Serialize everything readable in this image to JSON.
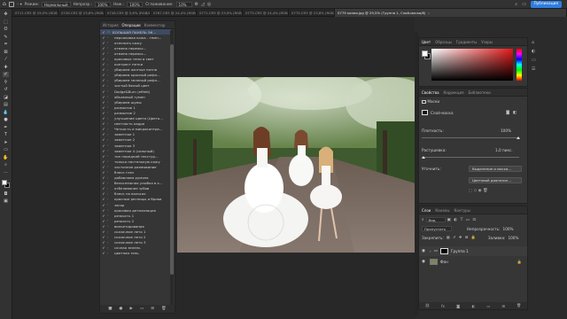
{
  "options_bar": {
    "mode_label": "Режим:",
    "mode_value": "Нормальный",
    "opacity_label": "Непрозр.:",
    "opacity_value": "100%",
    "flow_label": "Наж.:",
    "flow_value": "100%",
    "smoothing_label": "Сглаживание:",
    "smoothing_value": "10%",
    "share_label": "Публикация"
  },
  "tabs": [
    {
      "label": "0711.CR3 @ 29,5% (RGB/8...",
      "active": false
    },
    {
      "label": "0726.CR3 @ 23,8% (RGB/8)",
      "active": false
    },
    {
      "label": "0728.CR3 @ 5,6% (RGB/8)",
      "active": false
    },
    {
      "label": "0767.CR3 @ 24,4% (RGB/8)",
      "active": false
    },
    {
      "label": "0771.CR3 @ 23,9% (RGB/8)",
      "active": false
    },
    {
      "label": "0773.CR3 @ 24,4% (RGB/8)",
      "active": false
    },
    {
      "label": "0775.CR3 @ 23,8% (RGB/8)",
      "active": false
    },
    {
      "label": "0779 копия.jpg @ 29,5% (Группа 1, Слой-маска/8)",
      "active": true
    }
  ],
  "history": {
    "tabs": [
      "История",
      "Операции",
      "Комментар"
    ],
    "group_title": "БОЛЬШАЯ ПАНЕЛЬ ЭК...",
    "items": [
      "персиковая кожа - темн...",
      "отеплить кожу",
      "отмена переокс...",
      "отмена переокс...",
      "красивые тени и свет",
      "контраст нетки",
      "убираем желтые пятна",
      "убираем красный рефл...",
      "убираем зеленый рефл...",
      "чистый белый цвет",
      "Dodge&Burn (effekt)",
      "объемный тумен",
      "убираем шумы",
      "размытие 1",
      "размытие 2",
      "улучшение цвета (Цвето...",
      "светлость кадра",
      "Четкость и микроконтра...",
      "заметное 1",
      "заметное 2",
      "заметное 3",
      "заметное 4 (сильный)",
      "тон передний текстур...",
      "только пастельную кожу",
      "частичное размывание",
      "блеск глаз",
      "добавляем румяна",
      "белоснежная улыбка в к...",
      "отбеливание зубов",
      "блеск на волосах",
      "красные ресницы и брови",
      "загар",
      "красивая детализация",
      "резкость 1",
      "резкость 2",
      "виньетирование",
      "сказочное лето 1",
      "сказочное лето 2",
      "сказочное лето 3",
      "сочная зелень",
      "цветная тень"
    ]
  },
  "color_panel": {
    "tabs": [
      "Цвет",
      "Образцы",
      "Градиенты",
      "Узоры"
    ],
    "accent": "#e31919"
  },
  "properties": {
    "tabs": [
      "Свойства",
      "Коррекция",
      "Библиотеки"
    ],
    "section_title": "Маски",
    "mask_label": "Слой-маска",
    "density_label": "Плотность:",
    "density_value": "100%",
    "feather_label": "Растушевка:",
    "feather_value": "1,0 пикс.",
    "refine_label": "Уточнить:",
    "select_mask_btn": "Выделение и маска...",
    "color_range_btn": "Цветовой диапазон..."
  },
  "layers": {
    "tabs": [
      "Слои",
      "Каналы",
      "Контуры"
    ],
    "kind_label": "Вид",
    "blend_value": "Пропустить",
    "opacity_label": "Непрозрачность:",
    "opacity_value": "100%",
    "lock_label": "Закрепить:",
    "fill_label": "Заливка:",
    "fill_value": "100%",
    "rows": [
      {
        "name": "Группа 1",
        "selected": true
      },
      {
        "name": "Фон",
        "selected": false
      }
    ]
  }
}
